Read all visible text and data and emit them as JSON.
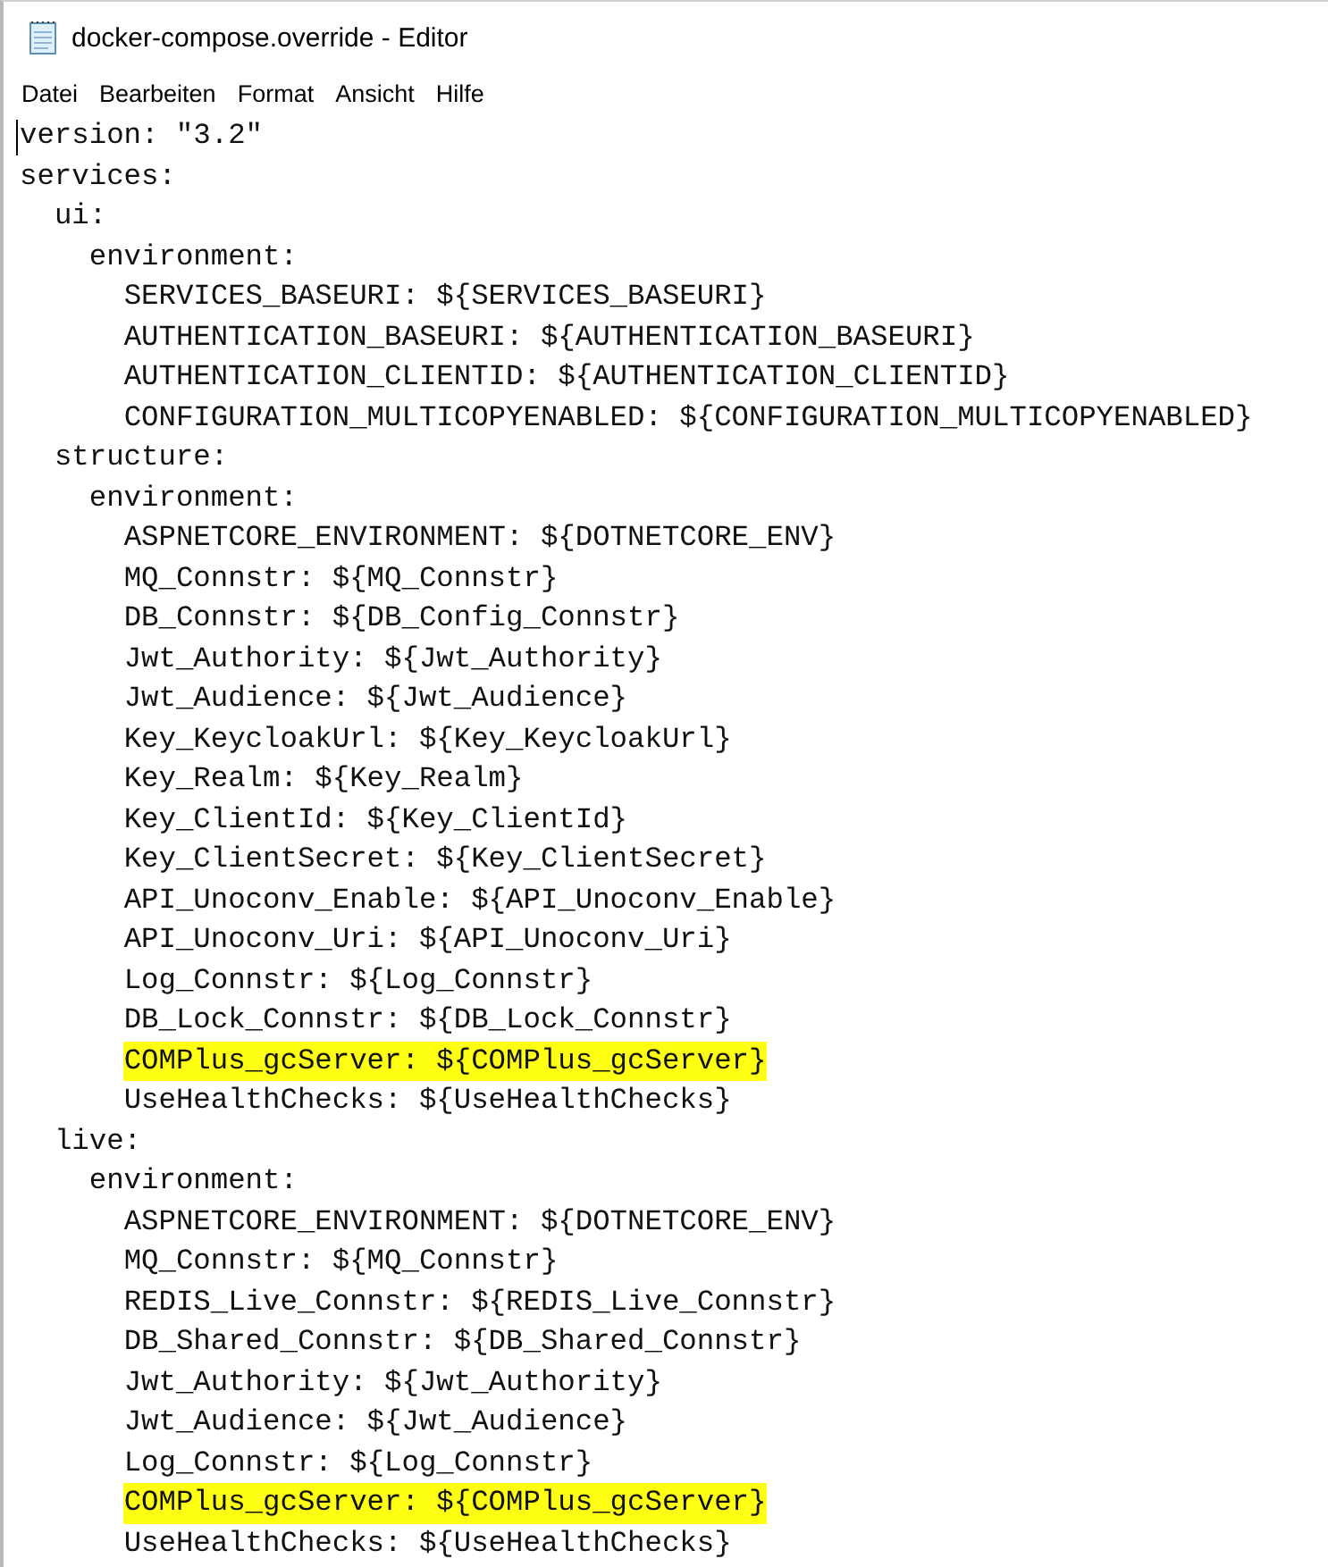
{
  "window": {
    "title": "docker-compose.override - Editor"
  },
  "menu": [
    "Datei",
    "Bearbeiten",
    "Format",
    "Ansicht",
    "Hilfe"
  ],
  "editor": {
    "lines": [
      {
        "text": "version: \"3.2\"",
        "highlighted": false
      },
      {
        "text": "services:",
        "highlighted": false
      },
      {
        "text": "  ui:",
        "highlighted": false
      },
      {
        "text": "    environment:",
        "highlighted": false
      },
      {
        "text": "      SERVICES_BASEURI: ${SERVICES_BASEURI}",
        "highlighted": false
      },
      {
        "text": "      AUTHENTICATION_BASEURI: ${AUTHENTICATION_BASEURI}",
        "highlighted": false
      },
      {
        "text": "      AUTHENTICATION_CLIENTID: ${AUTHENTICATION_CLIENTID}",
        "highlighted": false
      },
      {
        "text": "      CONFIGURATION_MULTICOPYENABLED: ${CONFIGURATION_MULTICOPYENABLED}",
        "highlighted": false
      },
      {
        "text": "  structure:",
        "highlighted": false
      },
      {
        "text": "    environment:",
        "highlighted": false
      },
      {
        "text": "      ASPNETCORE_ENVIRONMENT: ${DOTNETCORE_ENV}",
        "highlighted": false
      },
      {
        "text": "      MQ_Connstr: ${MQ_Connstr}",
        "highlighted": false
      },
      {
        "text": "      DB_Connstr: ${DB_Config_Connstr}",
        "highlighted": false
      },
      {
        "text": "      Jwt_Authority: ${Jwt_Authority}",
        "highlighted": false
      },
      {
        "text": "      Jwt_Audience: ${Jwt_Audience}",
        "highlighted": false
      },
      {
        "text": "      Key_KeycloakUrl: ${Key_KeycloakUrl}",
        "highlighted": false
      },
      {
        "text": "      Key_Realm: ${Key_Realm}",
        "highlighted": false
      },
      {
        "text": "      Key_ClientId: ${Key_ClientId}",
        "highlighted": false
      },
      {
        "text": "      Key_ClientSecret: ${Key_ClientSecret}",
        "highlighted": false
      },
      {
        "text": "      API_Unoconv_Enable: ${API_Unoconv_Enable}",
        "highlighted": false
      },
      {
        "text": "      API_Unoconv_Uri: ${API_Unoconv_Uri}",
        "highlighted": false
      },
      {
        "text": "      Log_Connstr: ${Log_Connstr}",
        "highlighted": false
      },
      {
        "text": "      DB_Lock_Connstr: ${DB_Lock_Connstr}",
        "highlighted": false
      },
      {
        "text": "      COMPlus_gcServer: ${COMPlus_gcServer}",
        "highlighted": true
      },
      {
        "text": "      UseHealthChecks: ${UseHealthChecks}",
        "highlighted": false
      },
      {
        "text": "  live:",
        "highlighted": false
      },
      {
        "text": "    environment:",
        "highlighted": false
      },
      {
        "text": "      ASPNETCORE_ENVIRONMENT: ${DOTNETCORE_ENV}",
        "highlighted": false
      },
      {
        "text": "      MQ_Connstr: ${MQ_Connstr}",
        "highlighted": false
      },
      {
        "text": "      REDIS_Live_Connstr: ${REDIS_Live_Connstr}",
        "highlighted": false
      },
      {
        "text": "      DB_Shared_Connstr: ${DB_Shared_Connstr}",
        "highlighted": false
      },
      {
        "text": "      Jwt_Authority: ${Jwt_Authority}",
        "highlighted": false
      },
      {
        "text": "      Jwt_Audience: ${Jwt_Audience}",
        "highlighted": false
      },
      {
        "text": "      Log_Connstr: ${Log_Connstr}",
        "highlighted": false
      },
      {
        "text": "      COMPlus_gcServer: ${COMPlus_gcServer}",
        "highlighted": true
      },
      {
        "text": "      UseHealthChecks: ${UseHealthChecks}",
        "highlighted": false
      }
    ]
  }
}
